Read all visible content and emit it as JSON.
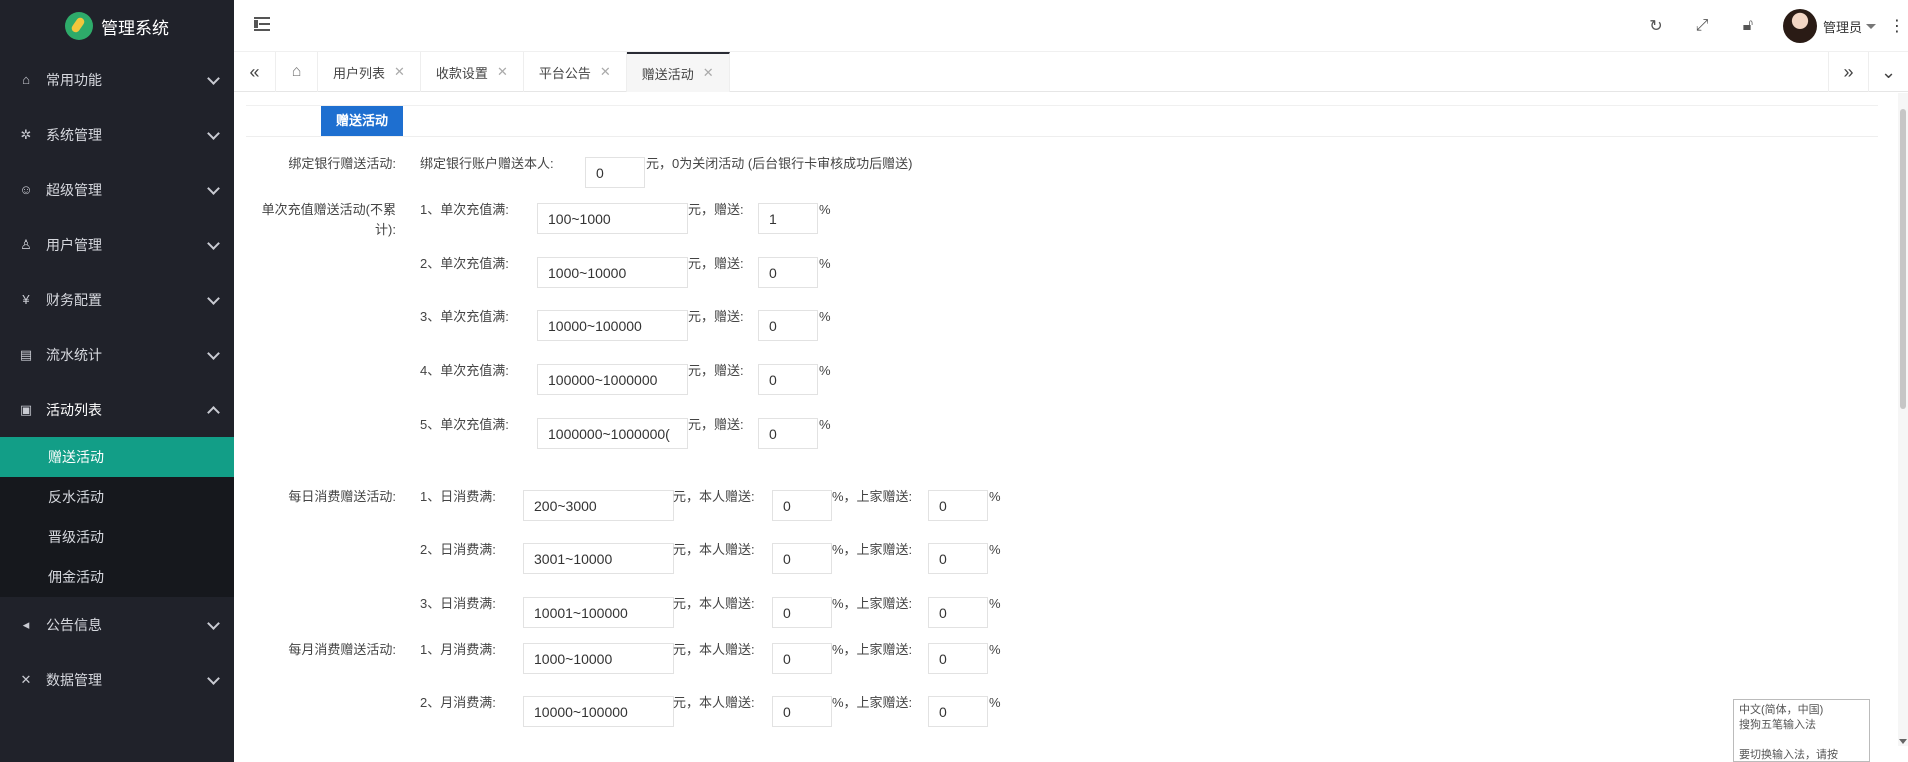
{
  "app": {
    "title": "管理系统"
  },
  "sidebar": {
    "items": [
      {
        "label": "常用功能",
        "icon": "home-icon",
        "open": false
      },
      {
        "label": "系统管理",
        "icon": "gear-icon",
        "open": false
      },
      {
        "label": "超级管理",
        "icon": "user-icon",
        "open": false
      },
      {
        "label": "用户管理",
        "icon": "users-icon",
        "open": false
      },
      {
        "label": "财务配置",
        "icon": "yen-icon",
        "open": false
      },
      {
        "label": "流水统计",
        "icon": "clipboard-icon",
        "open": false
      },
      {
        "label": "活动列表",
        "icon": "gift-icon",
        "open": true
      },
      {
        "label": "公告信息",
        "icon": "speaker-icon",
        "open": false
      },
      {
        "label": "数据管理",
        "icon": "tools-icon",
        "open": false
      }
    ],
    "sub_items": [
      {
        "label": "赠送活动",
        "active": true
      },
      {
        "label": "反水活动",
        "active": false
      },
      {
        "label": "晋级活动",
        "active": false
      },
      {
        "label": "佣金活动",
        "active": false
      }
    ]
  },
  "header": {
    "user_name": "管理员"
  },
  "tabs": [
    {
      "label": "用户列表",
      "active": false
    },
    {
      "label": "收款设置",
      "active": false
    },
    {
      "label": "平台公告",
      "active": false
    },
    {
      "label": "赠送活动",
      "active": true
    }
  ],
  "form": {
    "panel_tab": "赠送活动",
    "bank": {
      "label": "绑定银行赠送活动:",
      "prefix": "绑定银行账户赠送本人:",
      "value": "0",
      "suffix": "元，0为关闭活动 (后台银行卡审核成功后赠送)"
    },
    "single_recharge": {
      "label": "单次充值赠送活动(不累计):",
      "rows": [
        {
          "prefix": "1、单次充值满:",
          "range": "100~1000",
          "unit": "元，赠送:",
          "bonus": "1",
          "pct": "%"
        },
        {
          "prefix": "2、单次充值满:",
          "range": "1000~10000",
          "unit": "元，赠送:",
          "bonus": "0",
          "pct": "%"
        },
        {
          "prefix": "3、单次充值满:",
          "range": "10000~100000",
          "unit": "元，赠送:",
          "bonus": "0",
          "pct": "%"
        },
        {
          "prefix": "4、单次充值满:",
          "range": "100000~1000000",
          "unit": "元，赠送:",
          "bonus": "0",
          "pct": "%"
        },
        {
          "prefix": "5、单次充值满:",
          "range": "1000000~1000000(",
          "unit": "元，赠送:",
          "bonus": "0",
          "pct": "%"
        }
      ]
    },
    "daily": {
      "label": "每日消费赠送活动:",
      "rows": [
        {
          "prefix": "1、日消费满:",
          "range": "200~3000",
          "unit": "元，本人赠送:",
          "self": "0",
          "mid": "%，上家赠送:",
          "upper": "0",
          "pct": "%"
        },
        {
          "prefix": "2、日消费满:",
          "range": "3001~10000",
          "unit": "元，本人赠送:",
          "self": "0",
          "mid": "%，上家赠送:",
          "upper": "0",
          "pct": "%"
        },
        {
          "prefix": "3、日消费满:",
          "range": "10001~100000",
          "unit": "元，本人赠送:",
          "self": "0",
          "mid": "%，上家赠送:",
          "upper": "0",
          "pct": "%"
        }
      ]
    },
    "monthly": {
      "label": "每月消费赠送活动:",
      "rows": [
        {
          "prefix": "1、月消费满:",
          "range": "1000~10000",
          "unit": "元，本人赠送:",
          "self": "0",
          "mid": "%，上家赠送:",
          "upper": "0",
          "pct": "%"
        },
        {
          "prefix": "2、月消费满:",
          "range": "10000~100000",
          "unit": "元，本人赠送:",
          "self": "0",
          "mid": "%，上家赠送:",
          "upper": "0",
          "pct": "%"
        }
      ]
    }
  },
  "ime": {
    "line1": "中文(简体，中国)",
    "line2": "搜狗五笔输入法",
    "line3": "要切换输入法，请按"
  }
}
